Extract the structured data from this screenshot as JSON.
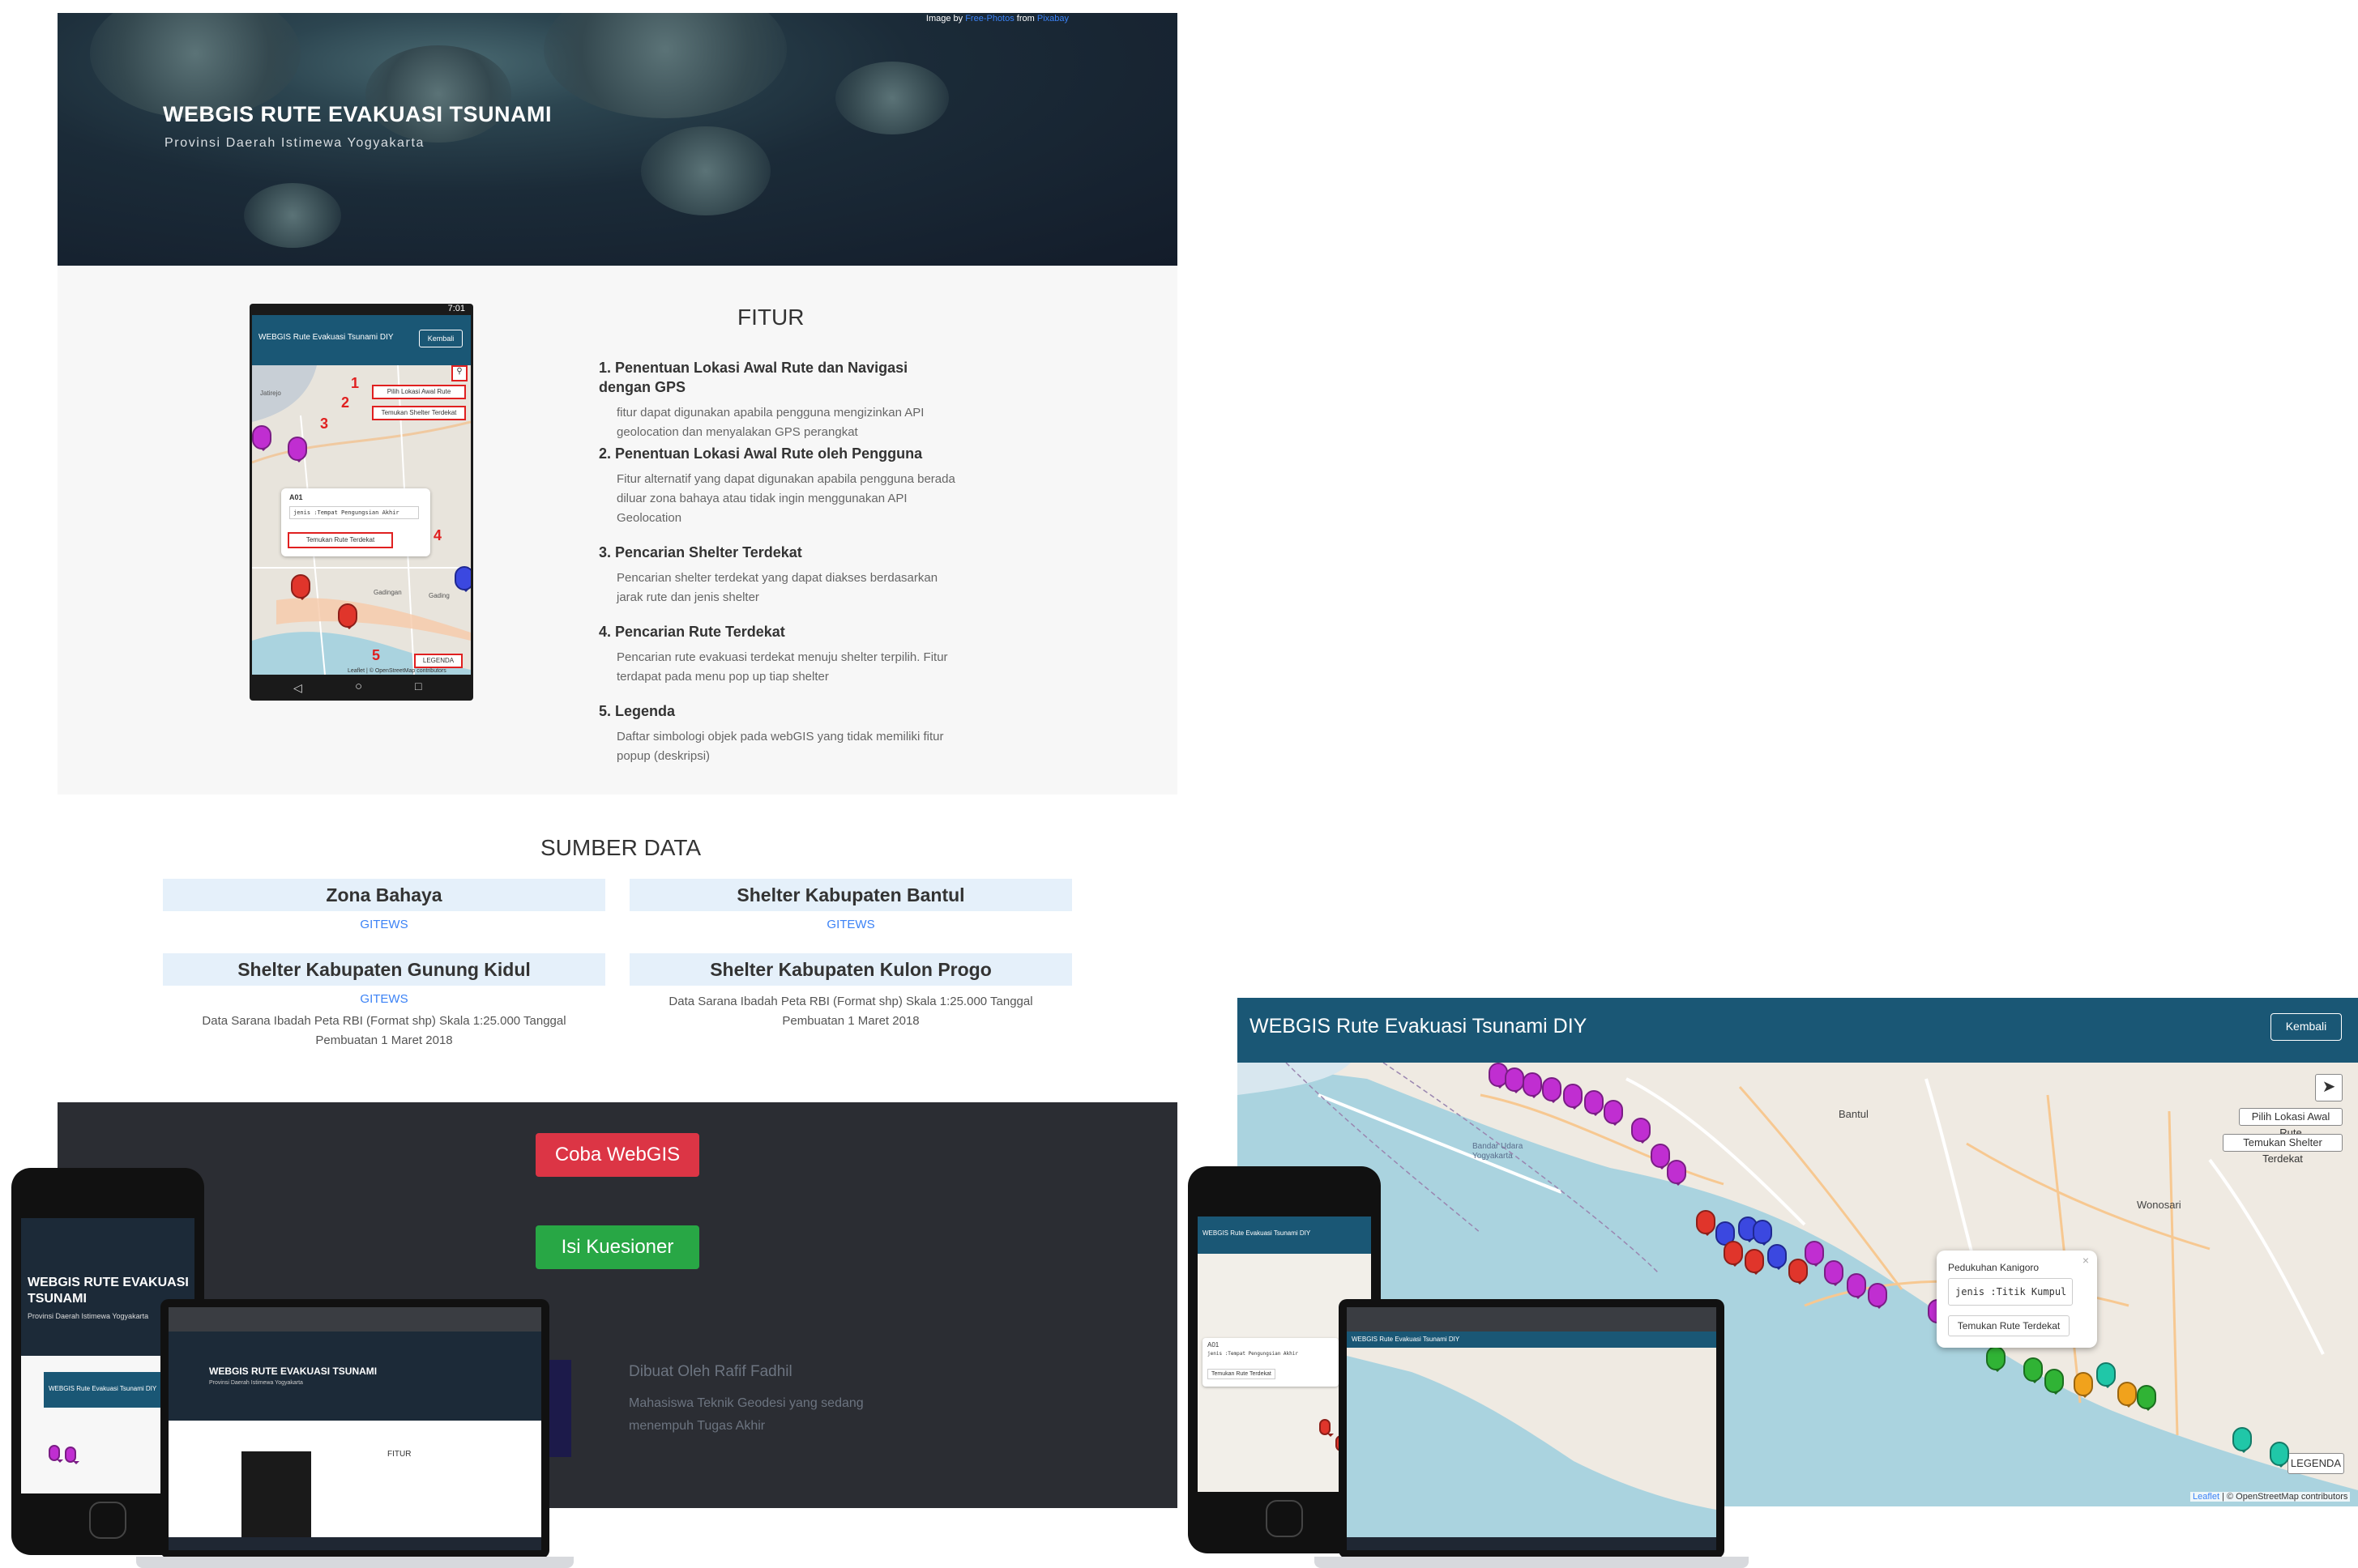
{
  "hero": {
    "title": "WEBGIS RUTE EVAKUASI TSUNAMI",
    "subtitle": "Provinsi Daerah Istimewa Yogyakarta",
    "credit_prefix": "Image by",
    "credit_author": "Free-Photos",
    "credit_mid": "from",
    "credit_site": "Pixabay"
  },
  "fitur": {
    "heading": "FITUR",
    "items": [
      {
        "title": "1. Penentuan Lokasi Awal Rute dan Navigasi dengan GPS",
        "desc": "fitur dapat digunakan apabila pengguna mengizinkan API geolocation dan menyalakan GPS perangkat"
      },
      {
        "title": "2. Penentuan Lokasi Awal Rute oleh Pengguna",
        "desc": "Fitur alternatif yang dapat digunakan apabila pengguna berada diluar zona bahaya atau tidak ingin menggunakan API Geolocation"
      },
      {
        "title": "3. Pencarian Shelter Terdekat",
        "desc": "Pencarian shelter terdekat yang dapat diakses berdasarkan jarak rute dan jenis shelter"
      },
      {
        "title": "4. Pencarian Rute Terdekat",
        "desc": "Pencarian rute evakuasi terdekat menuju shelter terpilih. Fitur terdapat pada menu pop up tiap shelter"
      },
      {
        "title": "5. Legenda",
        "desc": "Daftar simbologi objek pada webGIS yang tidak memiliki fitur popup (deskripsi)"
      }
    ]
  },
  "phone_demo": {
    "time": "7:01",
    "app_title": "WEBGIS Rute Evakuasi Tsunami DIY",
    "back_label": "Kembali",
    "btn_pilih": "Pilih Lokasi Awal Rute",
    "btn_temukan_shelter": "Temukan Shelter Terdekat",
    "popup_name": "A01",
    "popup_jenis": "jenis :Tempat Pengungsian Akhir",
    "popup_btn": "Temukan Rute Terdekat",
    "legend_btn": "LEGENDA",
    "attribution": "Leaflet | © OpenStreetMap contributors",
    "markers": [
      "1",
      "2",
      "3",
      "4",
      "5"
    ],
    "places": [
      "Jatirejo",
      "Gadingan",
      "Gading"
    ]
  },
  "sumber": {
    "heading": "SUMBER DATA",
    "items": [
      {
        "title": "Zona Bahaya",
        "link": "GITEWS",
        "text": ""
      },
      {
        "title": "Shelter Kabupaten Bantul",
        "link": "GITEWS",
        "text": ""
      },
      {
        "title": "Shelter Kabupaten Gunung Kidul",
        "link": "GITEWS",
        "text": "Data Sarana Ibadah Peta RBI (Format shp) Skala 1:25.000 Tanggal Pembuatan 1 Maret 2018"
      },
      {
        "title": "Shelter Kabupaten Kulon Progo",
        "link": "",
        "text": "Data Sarana Ibadah Peta RBI (Format shp) Skala 1:25.000 Tanggal Pembuatan 1 Maret 2018"
      }
    ]
  },
  "footer": {
    "btn_webgis": "Coba WebGIS",
    "btn_kuesioner": "Isi Kuesioner",
    "author": "Dibuat Oleh Rafif Fadhil",
    "author_desc": "Mahasiswa Teknik Geodesi yang sedang menempuh Tugas Akhir"
  },
  "mockup_left": {
    "phone_title": "WEBGIS RUTE EVAKUASI TSUNAMI",
    "phone_sub": "Provinsi Daerah Istimewa Yogyakarta",
    "phone_app_title": "WEBGIS Rute Evakuasi Tsunami DIY",
    "laptop_title": "WEBGIS RUTE EVAKUASI TSUNAMI",
    "laptop_sub": "Provinsi Daerah Istimewa Yogyakarta",
    "laptop_heading": "FITUR"
  },
  "map": {
    "title": "WEBGIS Rute Evakuasi Tsunami DIY",
    "back_label": "Kembali",
    "btn_pilih": "Pilih Lokasi Awal Rute",
    "btn_temukan_shelter": "Temukan Shelter Terdekat",
    "popup_name": "Pedukuhan Kanigoro",
    "popup_jenis": "jenis :Titik Kumpul",
    "popup_btn": "Temukan Rute Terdekat",
    "legend_btn": "LEGENDA",
    "attribution_leaflet": "Leaflet",
    "attribution_rest": "| © OpenStreetMap contributors",
    "place_labels": [
      "Bantul",
      "Wonosari",
      "Bandar Udara Yogyakarta"
    ]
  },
  "mockup_right": {
    "phone_app_title": "WEBGIS Rute Evakuasi Tsunami DIY",
    "phone_popup_name": "A01",
    "phone_popup_jenis": "jenis :Tempat Pengungsian Akhir",
    "phone_popup_btn": "Temukan Rute Terdekat",
    "laptop_app_title": "WEBGIS Rute Evakuasi Tsunami DIY"
  },
  "colors": {
    "danger": "#dc3545",
    "success": "#28a745",
    "nav": "#1a5775",
    "link": "#3b82f6"
  }
}
